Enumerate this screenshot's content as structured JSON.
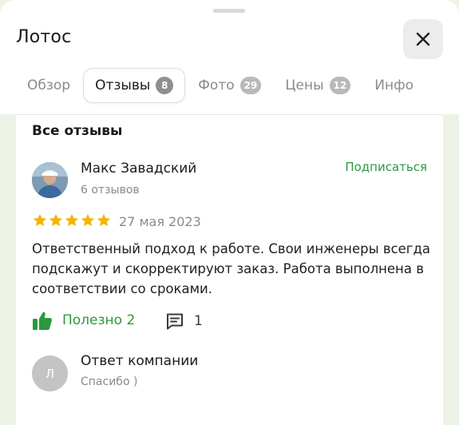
{
  "header": {
    "title": "Лотос",
    "close_icon": "close-icon"
  },
  "tabs": [
    {
      "label": "Обзор",
      "count": null,
      "active": false
    },
    {
      "label": "Отзывы",
      "count": "8",
      "active": true
    },
    {
      "label": "Фото",
      "count": "29",
      "active": false
    },
    {
      "label": "Цены",
      "count": "12",
      "active": false
    },
    {
      "label": "Инфо",
      "count": null,
      "active": false
    }
  ],
  "reviews": {
    "section_title": "Все отзывы",
    "items": [
      {
        "author": "Макс Завадский",
        "author_meta": "6 отзывов",
        "subscribe_label": "Подписаться",
        "rating": 5,
        "date": "27 мая 2023",
        "text": "Ответственный подход к работе. Свои инженеры всегда подскажут и скорректируют заказ. Работа выполнена в соответствии со сроками.",
        "helpful_label": "Полезно 2",
        "comments_count": "1",
        "reply": {
          "avatar_letter": "Л",
          "title": "Ответ компании",
          "text": "Спасибо )"
        }
      }
    ]
  },
  "colors": {
    "accent_green": "#2a9a3c",
    "star_yellow": "#f5b400",
    "background": "#eef3e7"
  },
  "icons": {
    "like": "thumbs-up-icon",
    "comment": "comment-icon",
    "star": "star-icon"
  }
}
